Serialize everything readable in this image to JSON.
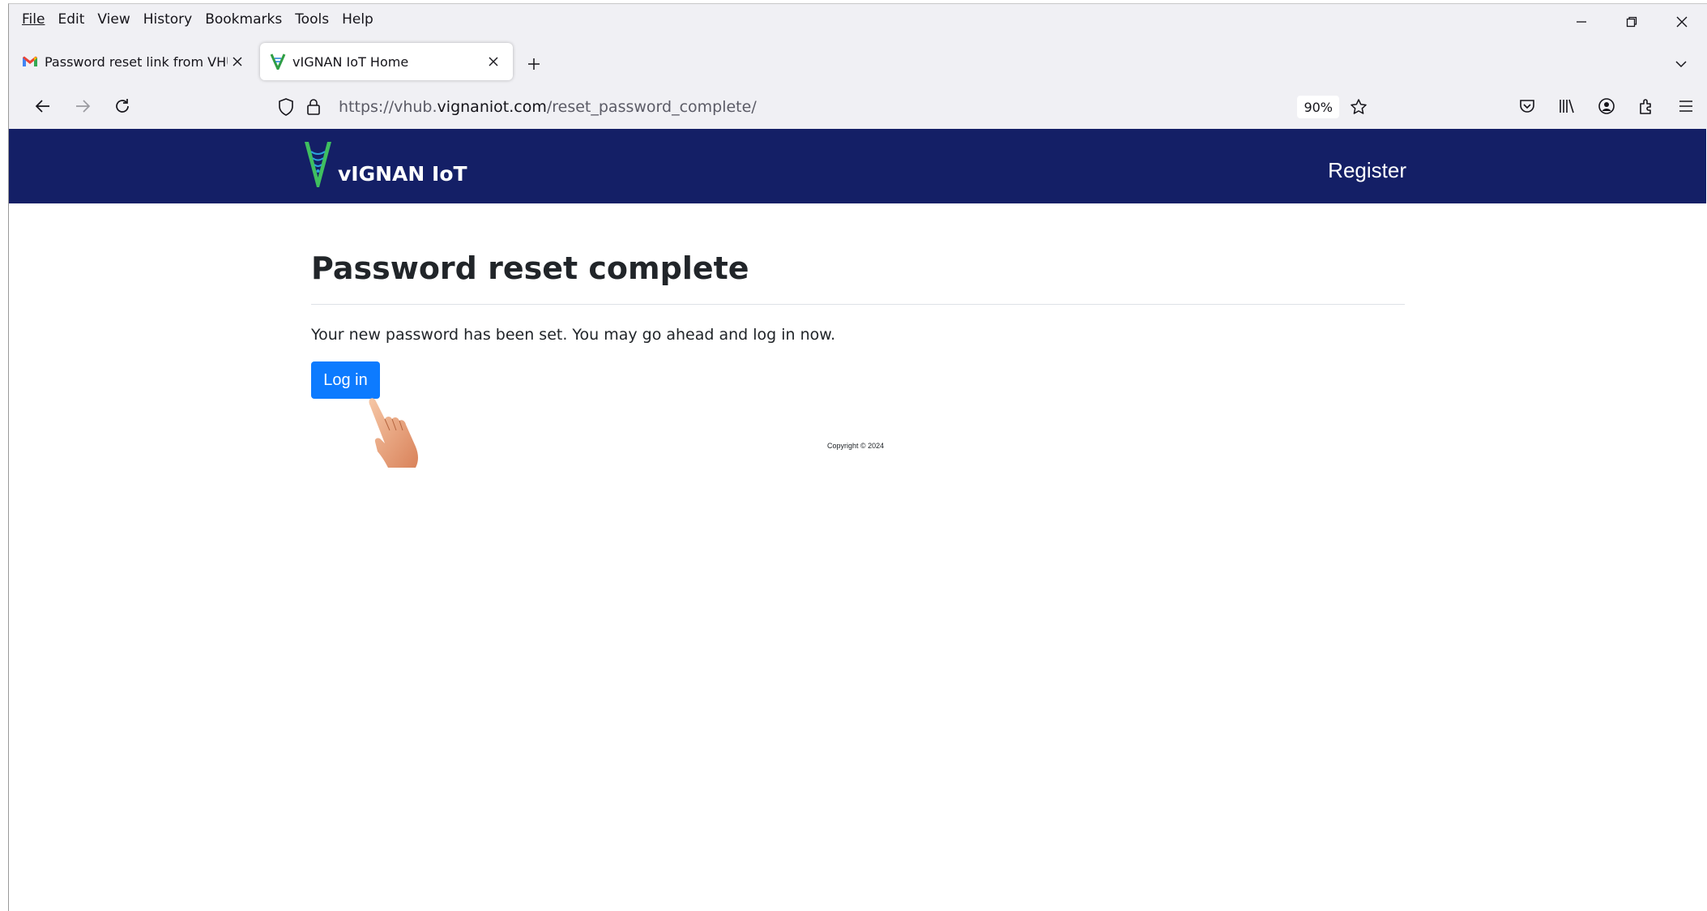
{
  "menu": {
    "file": "File",
    "edit": "Edit",
    "view": "View",
    "history": "History",
    "bookmarks": "Bookmarks",
    "tools": "Tools",
    "help": "Help"
  },
  "tabs": [
    {
      "label": "Password reset link from VHUB.V",
      "icon": "gmail-icon"
    },
    {
      "label": "vIGNAN IoT Home",
      "icon": "vignan-favicon"
    }
  ],
  "address_bar": {
    "url_prefix": "https://vhub.",
    "url_host": "vignaniot.com",
    "url_path": "/reset_password_complete/",
    "zoom": "90%"
  },
  "site": {
    "brand_name": "vIGNAN IoT",
    "register_label": "Register",
    "header_color": "#141f66"
  },
  "main": {
    "title": "Password reset complete",
    "message": "Your new password has been set. You may go ahead and log in now.",
    "login_label": "Log in",
    "login_color": "#0d7bff"
  },
  "footer": {
    "copyright": "Copyright © 2024"
  }
}
